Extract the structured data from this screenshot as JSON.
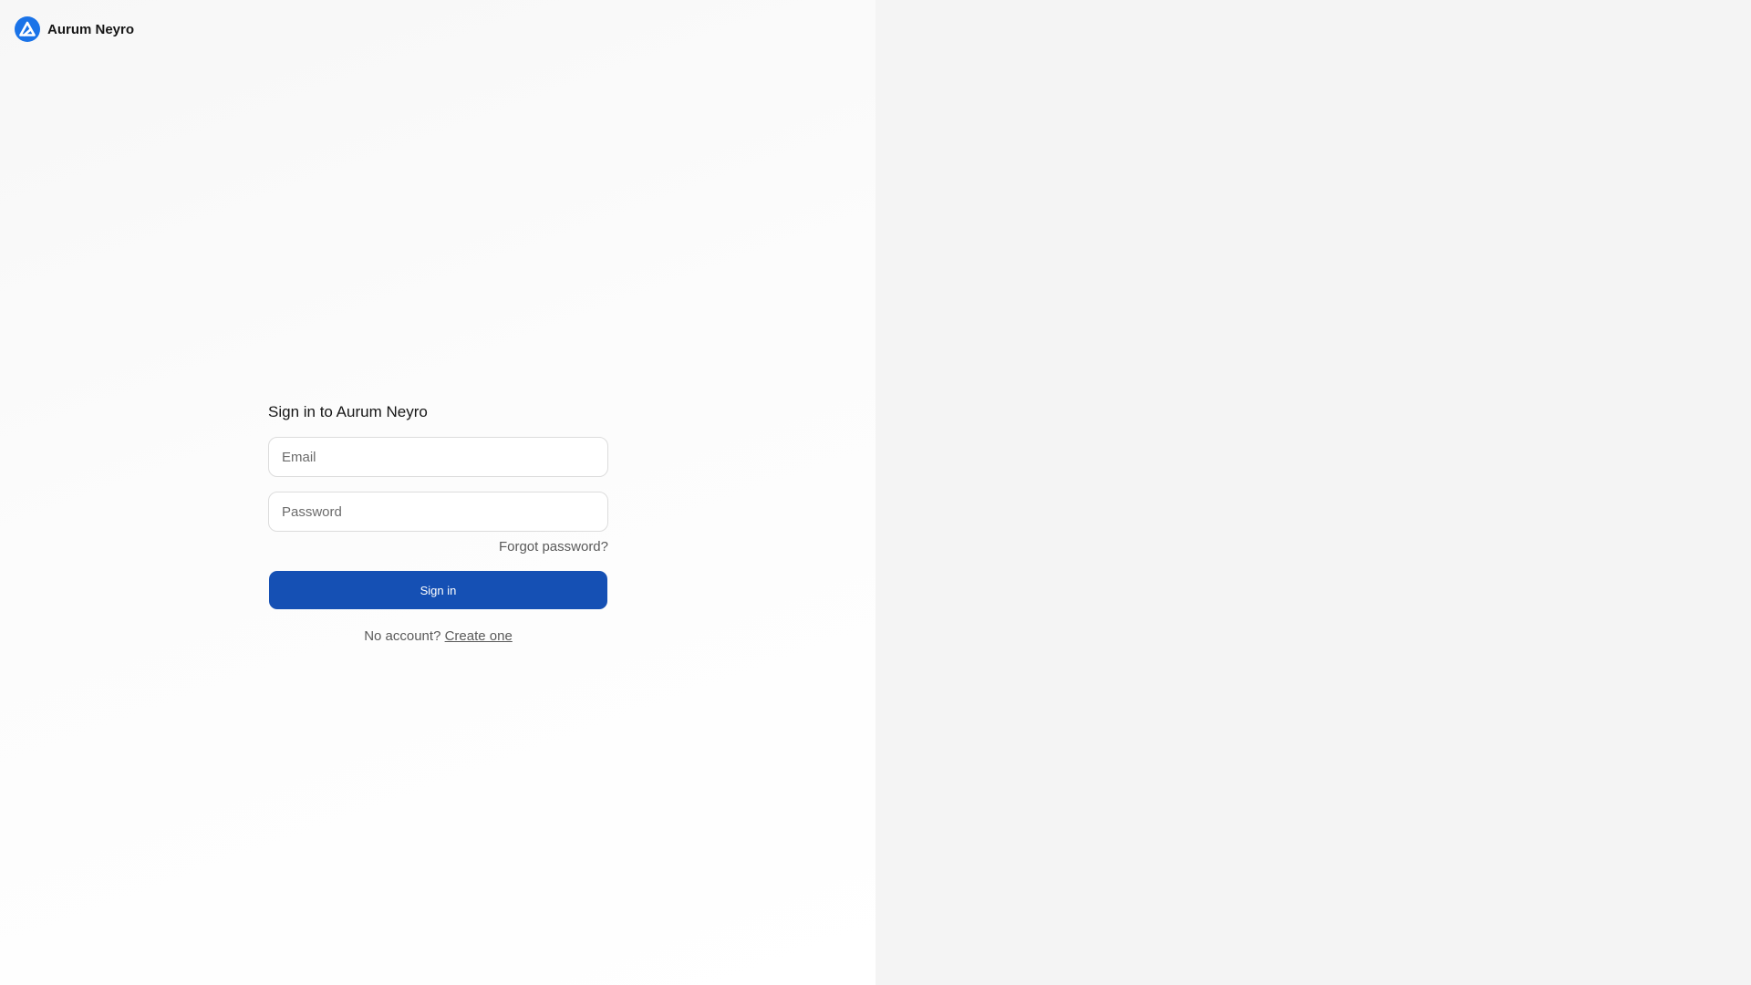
{
  "brand": {
    "name": "Aurum Neyro",
    "logo_icon": "triangle-a-logo-icon",
    "logo_color": "#1a73e8"
  },
  "form": {
    "title": "Sign in to Aurum Neyro",
    "email_placeholder": "Email",
    "password_placeholder": "Password",
    "forgot_label": "Forgot password?",
    "submit_label": "Sign in",
    "signup_prompt": "No account?",
    "signup_link_label": "Create one"
  },
  "colors": {
    "primary_button": "#1550b4",
    "right_panel": "#f4f4f4"
  }
}
